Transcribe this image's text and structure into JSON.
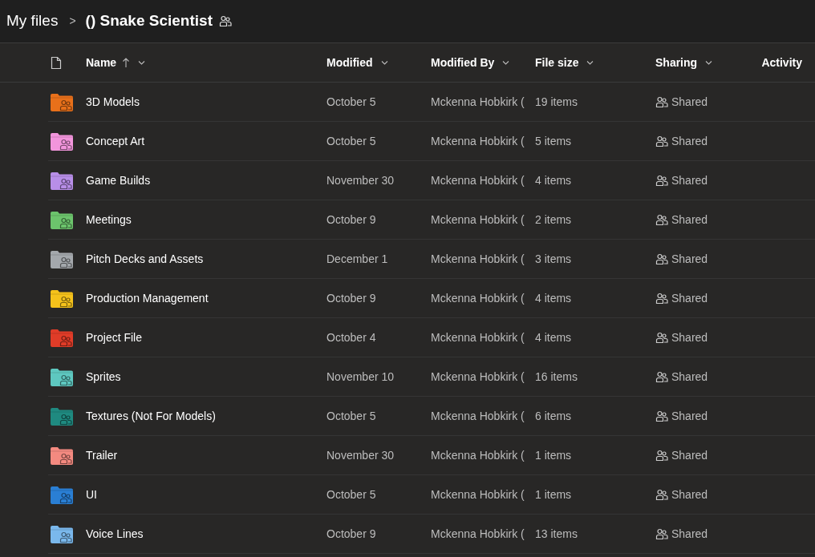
{
  "breadcrumb": {
    "parent": "My files",
    "separator": ">",
    "current": "() Snake Scientist",
    "shared": true
  },
  "columns": [
    {
      "label": "Name",
      "sorted": true,
      "menu": true
    },
    {
      "label": "Modified",
      "sorted": false,
      "menu": true
    },
    {
      "label": "Modified By",
      "sorted": false,
      "menu": true
    },
    {
      "label": "File size",
      "sorted": false,
      "menu": true
    },
    {
      "label": "Sharing",
      "sorted": false,
      "menu": true
    },
    {
      "label": "Activity",
      "sorted": false,
      "menu": false
    }
  ],
  "rows": [
    {
      "name": "3D Models",
      "color": "#e8701a",
      "modified": "October 5",
      "modified_by": "Mckenna Hobkirk (",
      "size": "19 items",
      "sharing": "Shared"
    },
    {
      "name": "Concept Art",
      "color": "#f295dc",
      "modified": "October 5",
      "modified_by": "Mckenna Hobkirk (",
      "size": "5 items",
      "sharing": "Shared"
    },
    {
      "name": "Game Builds",
      "color": "#b88ee8",
      "modified": "November 30",
      "modified_by": "Mckenna Hobkirk (",
      "size": "4 items",
      "sharing": "Shared"
    },
    {
      "name": "Meetings",
      "color": "#6cc46c",
      "modified": "October 9",
      "modified_by": "Mckenna Hobkirk (",
      "size": "2 items",
      "sharing": "Shared"
    },
    {
      "name": "Pitch Decks and Assets",
      "color": "#a4a8ac",
      "modified": "December 1",
      "modified_by": "Mckenna Hobkirk (",
      "size": "3 items",
      "sharing": "Shared"
    },
    {
      "name": "Production Management",
      "color": "#f5c21b",
      "modified": "October 9",
      "modified_by": "Mckenna Hobkirk (",
      "size": "4 items",
      "sharing": "Shared"
    },
    {
      "name": "Project File",
      "color": "#e03c28",
      "modified": "October 4",
      "modified_by": "Mckenna Hobkirk (",
      "size": "4 items",
      "sharing": "Shared"
    },
    {
      "name": "Sprites",
      "color": "#5ec8c0",
      "modified": "November 10",
      "modified_by": "Mckenna Hobkirk (",
      "size": "16 items",
      "sharing": "Shared"
    },
    {
      "name": "Textures (Not For Models)",
      "color": "#1f8a80",
      "modified": "October 5",
      "modified_by": "Mckenna Hobkirk (",
      "size": "6 items",
      "sharing": "Shared"
    },
    {
      "name": "Trailer",
      "color": "#f48a80",
      "modified": "November 30",
      "modified_by": "Mckenna Hobkirk (",
      "size": "1 items",
      "sharing": "Shared"
    },
    {
      "name": "UI",
      "color": "#2a7fd4",
      "modified": "October 5",
      "modified_by": "Mckenna Hobkirk (",
      "size": "1 items",
      "sharing": "Shared"
    },
    {
      "name": "Voice Lines",
      "color": "#7ab8ec",
      "modified": "October 9",
      "modified_by": "Mckenna Hobkirk (",
      "size": "13 items",
      "sharing": "Shared"
    }
  ]
}
